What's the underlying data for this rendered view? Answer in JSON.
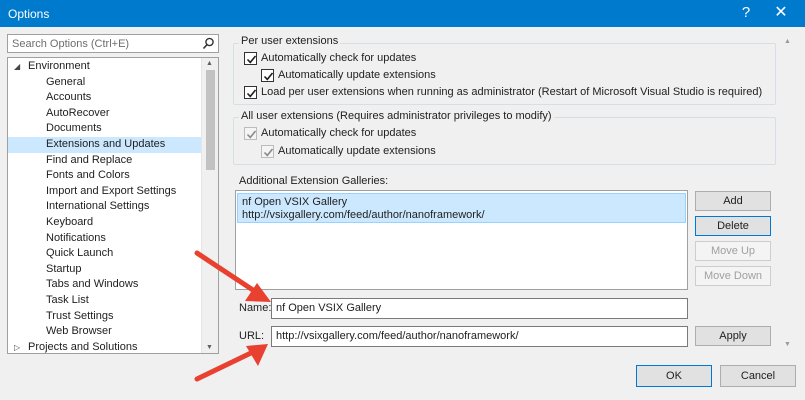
{
  "window": {
    "title": "Options",
    "help_label": "?",
    "close_label": "✕"
  },
  "search": {
    "placeholder": "Search Options (Ctrl+E)"
  },
  "tree": {
    "items": [
      {
        "label": "Environment",
        "level": 0,
        "expander": "◢",
        "selected": false
      },
      {
        "label": "General",
        "level": 1,
        "selected": false
      },
      {
        "label": "Accounts",
        "level": 1,
        "selected": false
      },
      {
        "label": "AutoRecover",
        "level": 1,
        "selected": false
      },
      {
        "label": "Documents",
        "level": 1,
        "selected": false
      },
      {
        "label": "Extensions and Updates",
        "level": 1,
        "selected": true
      },
      {
        "label": "Find and Replace",
        "level": 1,
        "selected": false
      },
      {
        "label": "Fonts and Colors",
        "level": 1,
        "selected": false
      },
      {
        "label": "Import and Export Settings",
        "level": 1,
        "selected": false
      },
      {
        "label": "International Settings",
        "level": 1,
        "selected": false
      },
      {
        "label": "Keyboard",
        "level": 1,
        "selected": false
      },
      {
        "label": "Notifications",
        "level": 1,
        "selected": false
      },
      {
        "label": "Quick Launch",
        "level": 1,
        "selected": false
      },
      {
        "label": "Startup",
        "level": 1,
        "selected": false
      },
      {
        "label": "Tabs and Windows",
        "level": 1,
        "selected": false
      },
      {
        "label": "Task List",
        "level": 1,
        "selected": false
      },
      {
        "label": "Trust Settings",
        "level": 1,
        "selected": false
      },
      {
        "label": "Web Browser",
        "level": 1,
        "selected": false
      },
      {
        "label": "Projects and Solutions",
        "level": 0,
        "expander": "▷",
        "selected": false
      }
    ]
  },
  "per_user": {
    "title": "Per user extensions",
    "auto_check": {
      "label": "Automatically check for updates",
      "checked": true
    },
    "auto_update": {
      "label": "Automatically update extensions",
      "checked": true
    },
    "load_admin": {
      "label": "Load per user extensions when running as administrator (Restart of Microsoft Visual Studio is required)",
      "checked": true
    }
  },
  "all_user": {
    "title": "All user extensions (Requires administrator privileges to modify)",
    "auto_check": {
      "label": "Automatically check for updates",
      "checked": true,
      "disabled": true
    },
    "auto_update": {
      "label": "Automatically update extensions",
      "checked": true,
      "disabled": true
    }
  },
  "galleries": {
    "title": "Additional Extension Galleries:",
    "items": [
      {
        "name": "nf Open VSIX Gallery",
        "url": "http://vsixgallery.com/feed/author/nanoframework/"
      }
    ],
    "add_label": "Add",
    "delete_label": "Delete",
    "move_up_label": "Move Up",
    "move_down_label": "Move Down"
  },
  "form": {
    "name_label": "Name:",
    "name_value": "nf Open VSIX Gallery",
    "url_label": "URL:",
    "url_value": "http://vsixgallery.com/feed/author/nanoframework/",
    "apply_label": "Apply"
  },
  "footer": {
    "ok_label": "OK",
    "cancel_label": "Cancel"
  },
  "colors": {
    "titlebar": "#007acc",
    "selection": "#cce8ff",
    "annotation_arrow": "#e8412f"
  }
}
